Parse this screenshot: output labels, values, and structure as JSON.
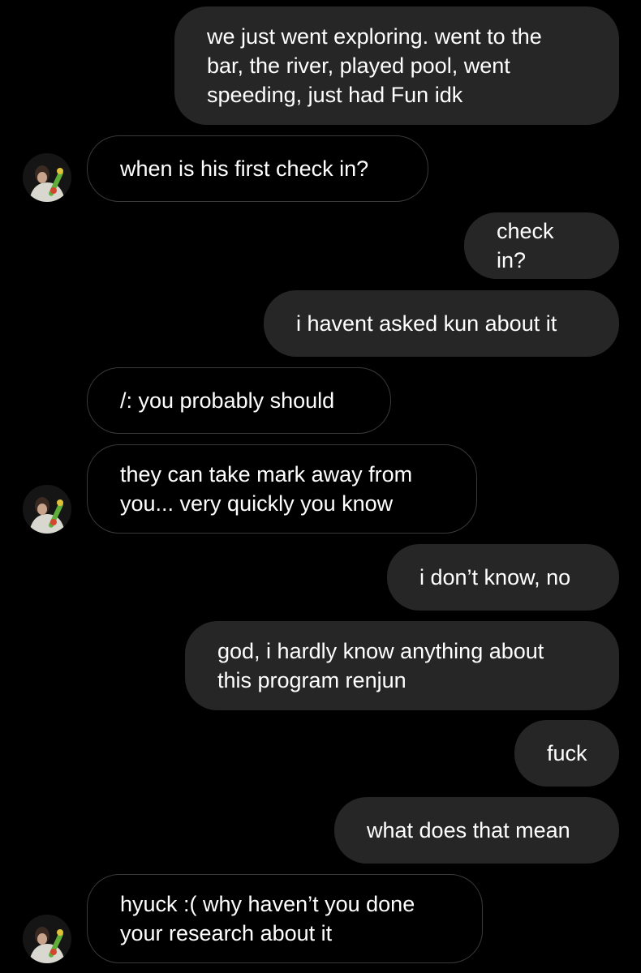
{
  "messages": [
    {
      "id": "m1",
      "side": "out",
      "text": "we just went exploring. went to the\nbar, the river, played pool, went\nspeeding, just had Fun idk"
    },
    {
      "id": "m2",
      "side": "in",
      "text": "when is his first check in?"
    },
    {
      "id": "m3",
      "side": "out",
      "text": "check in?"
    },
    {
      "id": "m4",
      "side": "out",
      "text": "i havent asked kun about it"
    },
    {
      "id": "m5",
      "side": "in",
      "text": "/: you probably should"
    },
    {
      "id": "m6",
      "side": "in",
      "text": "they can take mark away from\nyou... very quickly you know"
    },
    {
      "id": "m7",
      "side": "out",
      "text": "i don’t know, no"
    },
    {
      "id": "m8",
      "side": "out",
      "text": "god, i hardly know anything about\nthis program renjun"
    },
    {
      "id": "m9",
      "side": "out",
      "text": "fuck"
    },
    {
      "id": "m10",
      "side": "out",
      "text": "what does that mean"
    },
    {
      "id": "m11",
      "side": "in",
      "text": "hyuck :( why haven’t you done\nyour research about it"
    }
  ],
  "colors": {
    "background": "#000000",
    "outgoing_bubble": "#262626",
    "incoming_border": "#3a3a3a",
    "text": "#ffffff"
  },
  "icons": {
    "avatar": "contact-avatar-photo"
  }
}
